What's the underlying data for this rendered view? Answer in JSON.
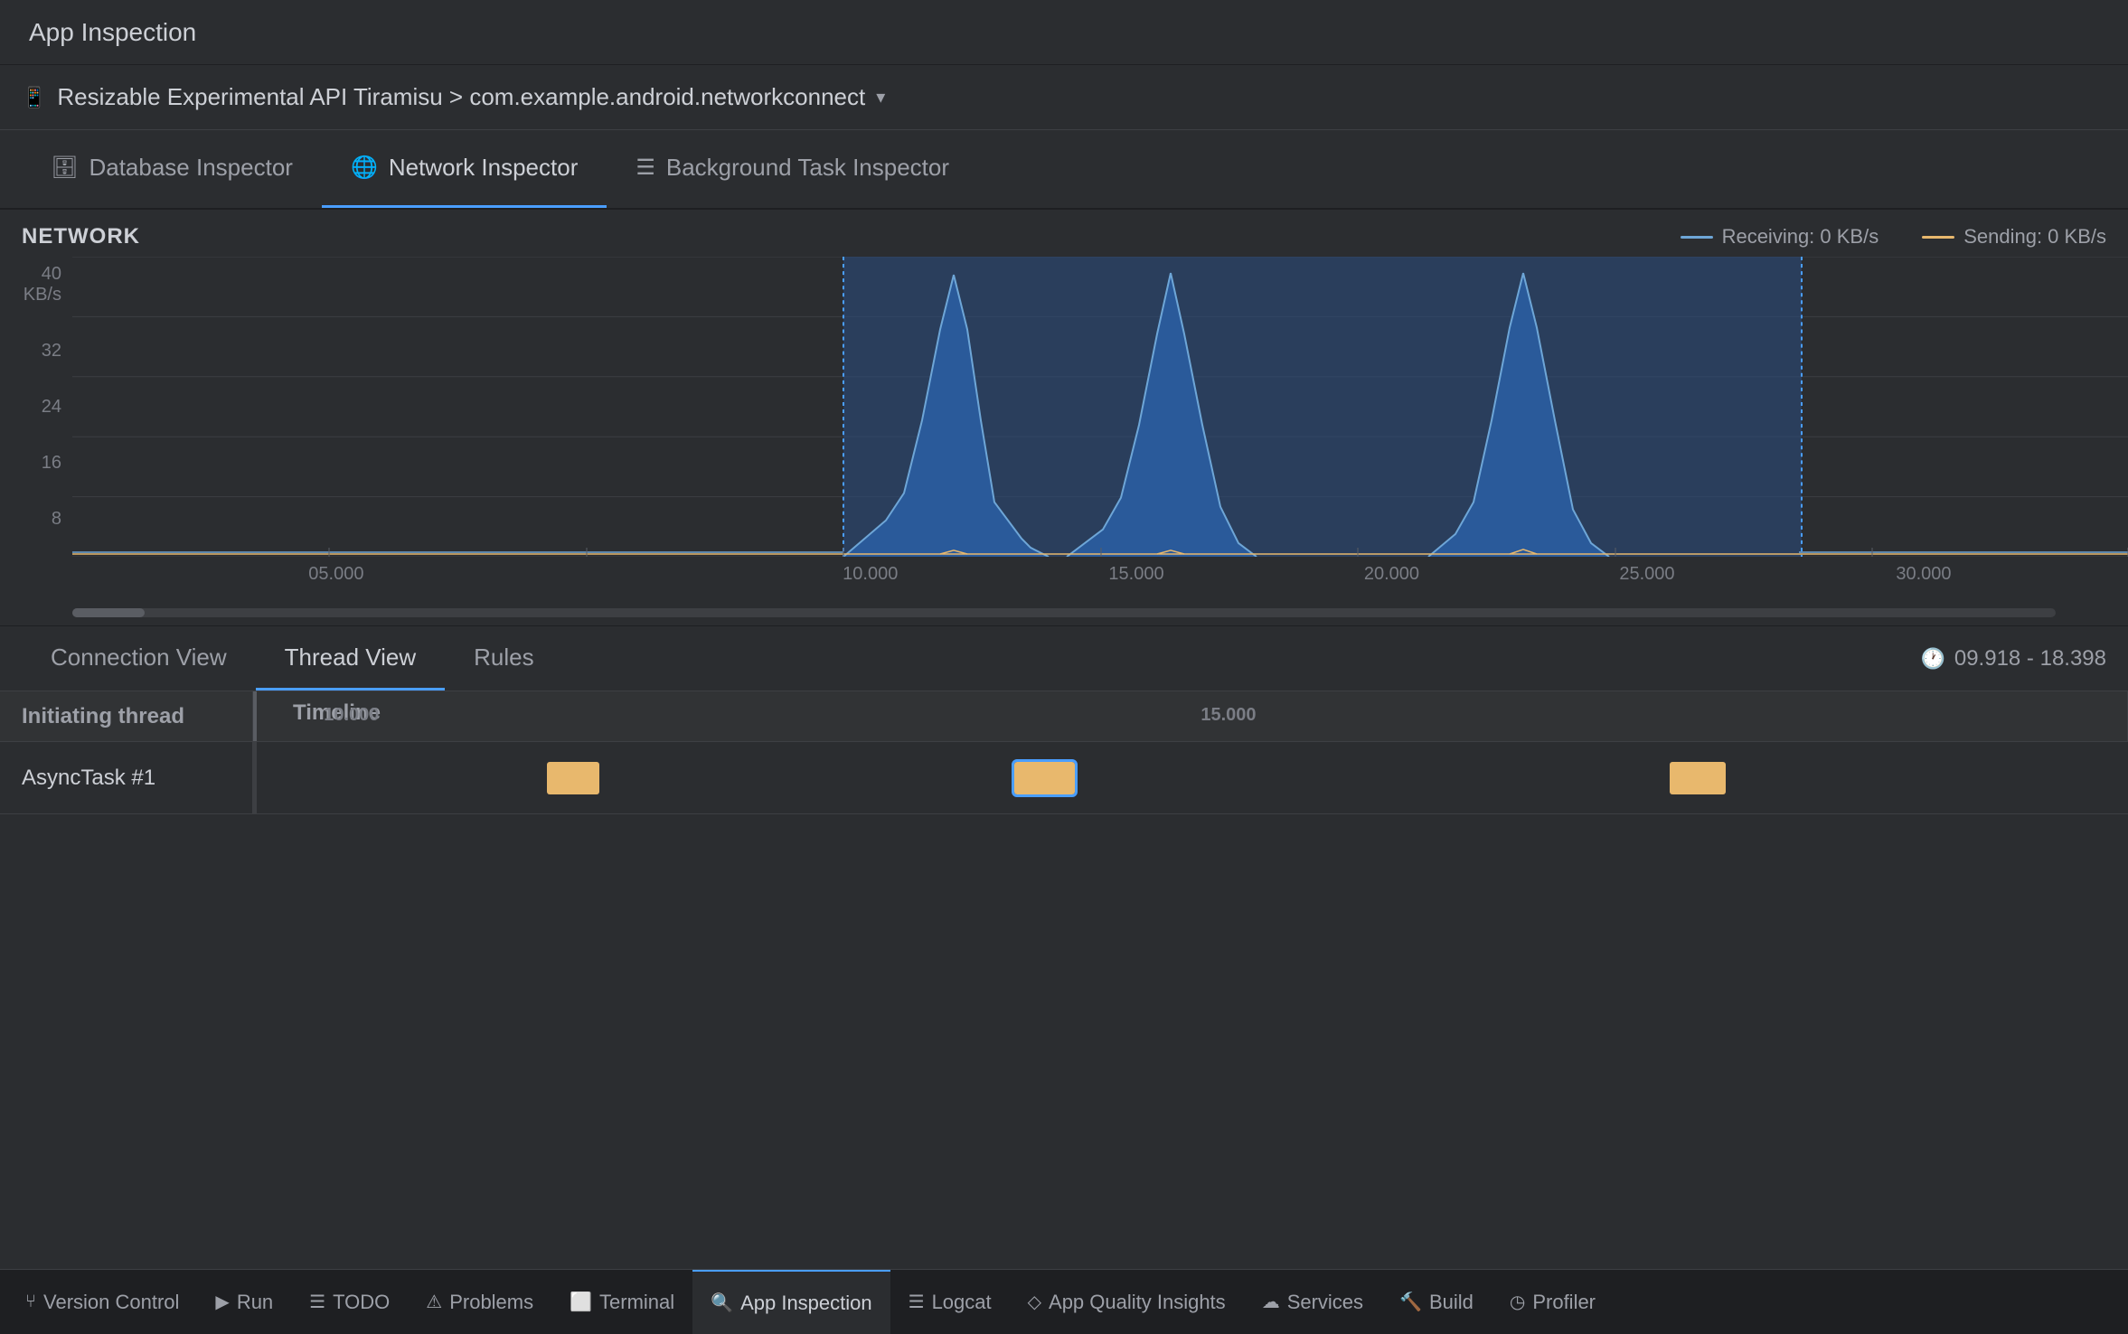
{
  "titleBar": {
    "title": "App Inspection"
  },
  "deviceBar": {
    "deviceName": "Resizable Experimental API Tiramisu > com.example.android.networkconnect",
    "icon": "📱"
  },
  "inspectorTabs": [
    {
      "id": "database",
      "label": "Database Inspector",
      "icon": "🗄",
      "active": false
    },
    {
      "id": "network",
      "label": "Network Inspector",
      "icon": "🌐",
      "active": true
    },
    {
      "id": "background",
      "label": "Background Task Inspector",
      "icon": "☰",
      "active": false
    }
  ],
  "networkChart": {
    "title": "NETWORK",
    "yAxisLabels": [
      "40 KB/s",
      "32",
      "24",
      "16",
      "8"
    ],
    "xAxisLabels": [
      "05.000",
      "10.000",
      "15.000",
      "20.000",
      "25.000",
      "30.000"
    ],
    "legend": {
      "receiving": {
        "label": "Receiving: 0 KB/s",
        "color": "#6ea6d7"
      },
      "sending": {
        "label": "Sending: 0 KB/s",
        "color": "#e8b86d"
      }
    },
    "selectedRegionStart": 0.375,
    "selectedRegionEnd": 0.635
  },
  "viewTabs": [
    {
      "id": "connection",
      "label": "Connection View",
      "active": false
    },
    {
      "id": "thread",
      "label": "Thread View",
      "active": true
    },
    {
      "id": "rules",
      "label": "Rules",
      "active": false
    }
  ],
  "timeRange": "09.918 - 18.398",
  "threadTable": {
    "columns": [
      {
        "id": "initiating",
        "label": "Initiating thread"
      },
      {
        "id": "timeline",
        "label": "Timeline"
      }
    ],
    "timelineLabels": [
      "10.000",
      "15.000"
    ],
    "rows": [
      {
        "name": "AsyncTask #1",
        "tasks": [
          {
            "id": 1,
            "leftPct": 15.5,
            "widthPct": 2.8,
            "selected": false
          },
          {
            "id": 2,
            "leftPct": 40.5,
            "widthPct": 3.2,
            "selected": true
          },
          {
            "id": 3,
            "leftPct": 75.5,
            "widthPct": 3.0,
            "selected": false
          }
        ]
      }
    ]
  },
  "statusBar": {
    "items": [
      {
        "id": "version-control",
        "icon": "⑂",
        "label": "Version Control",
        "active": false
      },
      {
        "id": "run",
        "icon": "▶",
        "label": "Run",
        "active": false
      },
      {
        "id": "todo",
        "icon": "☰",
        "label": "TODO",
        "active": false
      },
      {
        "id": "problems",
        "icon": "⚠",
        "label": "Problems",
        "active": false
      },
      {
        "id": "terminal",
        "icon": "⬜",
        "label": "Terminal",
        "active": false
      },
      {
        "id": "app-inspection",
        "icon": "🔍",
        "label": "App Inspection",
        "active": true
      },
      {
        "id": "logcat",
        "icon": "☰",
        "label": "Logcat",
        "active": false
      },
      {
        "id": "app-quality",
        "icon": "◇",
        "label": "App Quality Insights",
        "active": false
      },
      {
        "id": "services",
        "icon": "☁",
        "label": "Services",
        "active": false
      },
      {
        "id": "build",
        "icon": "🔨",
        "label": "Build",
        "active": false
      },
      {
        "id": "profiler",
        "icon": "◷",
        "label": "Profiler",
        "active": false
      }
    ]
  }
}
